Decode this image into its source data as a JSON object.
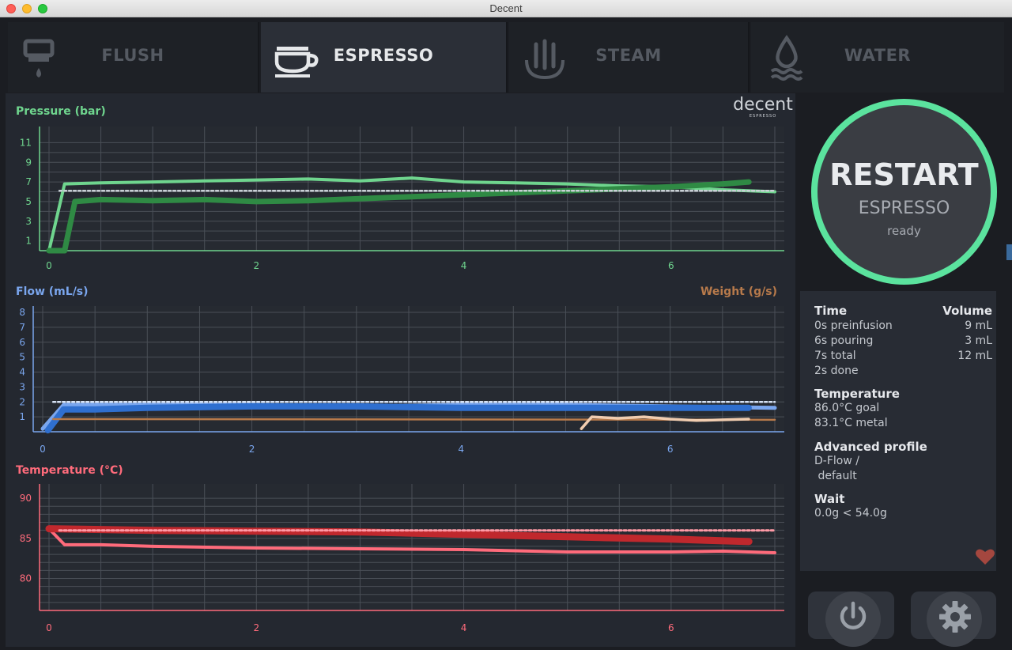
{
  "window": {
    "title": "Decent"
  },
  "tabs": [
    {
      "label": "FLUSH",
      "icon": "flush-icon",
      "active": false
    },
    {
      "label": "ESPRESSO",
      "icon": "espresso-cup-icon",
      "active": true
    },
    {
      "label": "STEAM",
      "icon": "steam-icon",
      "active": false
    },
    {
      "label": "WATER",
      "icon": "water-icon",
      "active": false
    }
  ],
  "logo": {
    "text": "decent",
    "subtext": "ESPRESSO"
  },
  "restart": {
    "title": "RESTART",
    "subtitle": "ESPRESSO",
    "state": "ready"
  },
  "stats": {
    "time_header": "Time",
    "volume_header": "Volume",
    "rows": [
      {
        "time": "0s preinfusion",
        "volume": "9 mL"
      },
      {
        "time": "6s pouring",
        "volume": "3 mL"
      },
      {
        "time": "7s total",
        "volume": "12 mL"
      },
      {
        "time": "2s done",
        "volume": ""
      }
    ],
    "temperature_header": "Temperature",
    "temperature_goal": "86.0°C goal",
    "temperature_metal": "83.1°C metal",
    "profile_header": "Advanced profile",
    "profile_line1": "D-Flow /",
    "profile_line2": " default",
    "wait_header": "Wait",
    "wait_value": "0.0g < 54.0g"
  },
  "colors": {
    "pressure": "#6fd58e",
    "pressure_dark": "#2f8a44",
    "flow": "#7aa6ee",
    "flow_dark": "#2f6fcf",
    "weight": "#b77a4b",
    "weight_light": "#f1cdb0",
    "temperature": "#ff6b7b",
    "temperature_dark": "#c0282d",
    "ring": "#5be39e"
  },
  "chart_data": [
    {
      "type": "line",
      "title": "Pressure (bar)",
      "xlim": [
        0,
        7
      ],
      "ylim": [
        0,
        12
      ],
      "x_ticks": [
        0,
        2,
        4,
        6
      ],
      "y_ticks": [
        1,
        3,
        5,
        7,
        9,
        11
      ],
      "series": [
        {
          "values": [
            [
              0,
              0
            ],
            [
              0.15,
              6.8
            ],
            [
              0.5,
              6.9
            ],
            [
              1,
              7.0
            ],
            [
              1.5,
              7.1
            ],
            [
              2,
              7.2
            ],
            [
              2.5,
              7.3
            ],
            [
              3,
              7.1
            ],
            [
              3.5,
              7.4
            ],
            [
              4,
              7.0
            ],
            [
              4.5,
              6.9
            ],
            [
              5,
              6.8
            ],
            [
              5.5,
              6.6
            ],
            [
              6,
              6.5
            ],
            [
              6.5,
              6.2
            ],
            [
              7,
              6.0
            ]
          ]
        },
        {
          "values": [
            [
              0,
              0
            ],
            [
              0.15,
              0
            ],
            [
              0.25,
              5.0
            ],
            [
              0.5,
              5.2
            ],
            [
              1,
              5.1
            ],
            [
              1.5,
              5.2
            ],
            [
              2,
              5.0
            ],
            [
              2.5,
              5.1
            ],
            [
              3,
              5.3
            ],
            [
              3.5,
              5.5
            ],
            [
              4,
              5.7
            ],
            [
              4.5,
              5.9
            ],
            [
              5,
              6.1
            ],
            [
              5.5,
              6.3
            ],
            [
              6,
              6.5
            ],
            [
              6.5,
              6.8
            ],
            [
              6.75,
              7.0
            ]
          ]
        },
        {
          "values": [
            [
              0.1,
              6.1
            ],
            [
              7,
              6.1
            ]
          ]
        }
      ]
    },
    {
      "type": "line",
      "title": "Flow (mL/s)",
      "y2label": "Weight (g/s)",
      "xlim": [
        0,
        7
      ],
      "ylim": [
        0,
        8
      ],
      "x_ticks": [
        0,
        2,
        4,
        6
      ],
      "y_ticks": [
        1,
        2,
        3,
        4,
        5,
        6,
        7,
        8
      ],
      "series": [
        {
          "values": [
            [
              0,
              0.2
            ],
            [
              0.2,
              1.8
            ],
            [
              0.5,
              1.8
            ],
            [
              1,
              1.8
            ],
            [
              2,
              1.8
            ],
            [
              3,
              1.7
            ],
            [
              4,
              1.8
            ],
            [
              5,
              1.8
            ],
            [
              6,
              1.7
            ],
            [
              7,
              1.6
            ]
          ]
        },
        {
          "values": [
            [
              0.05,
              0.1
            ],
            [
              0.2,
              1.5
            ],
            [
              0.5,
              1.5
            ],
            [
              1,
              1.6
            ],
            [
              2,
              1.7
            ],
            [
              3,
              1.7
            ],
            [
              4,
              1.6
            ],
            [
              5,
              1.6
            ],
            [
              6,
              1.6
            ],
            [
              6.75,
              1.6
            ]
          ]
        },
        {
          "values": [
            [
              0.1,
              2.0
            ],
            [
              7,
              2.0
            ]
          ]
        },
        {
          "values": [
            [
              0.1,
              0.85
            ],
            [
              7,
              0.8
            ]
          ]
        },
        {
          "values": [
            [
              5.15,
              0.2
            ],
            [
              5.25,
              1.0
            ],
            [
              5.5,
              0.9
            ],
            [
              5.75,
              1.0
            ],
            [
              6,
              0.85
            ],
            [
              6.25,
              0.75
            ],
            [
              6.5,
              0.8
            ],
            [
              6.75,
              0.85
            ]
          ]
        }
      ]
    },
    {
      "type": "line",
      "title": "Temperature (°C)",
      "xlim": [
        0,
        7
      ],
      "ylim": [
        76,
        91
      ],
      "x_ticks": [
        0,
        2,
        4,
        6
      ],
      "y_ticks": [
        80,
        85,
        90
      ],
      "series": [
        {
          "values": [
            [
              0,
              86.2
            ],
            [
              0.15,
              84.2
            ],
            [
              0.5,
              84.2
            ],
            [
              1,
              84.0
            ],
            [
              2,
              83.8
            ],
            [
              3,
              83.7
            ],
            [
              4,
              83.6
            ],
            [
              5,
              83.3
            ],
            [
              6,
              83.3
            ],
            [
              6.5,
              83.4
            ],
            [
              7,
              83.2
            ]
          ]
        },
        {
          "values": [
            [
              0,
              86.2
            ],
            [
              1,
              86.0
            ],
            [
              2,
              85.9
            ],
            [
              3,
              85.8
            ],
            [
              4,
              85.5
            ],
            [
              5,
              85.2
            ],
            [
              6,
              84.9
            ],
            [
              6.75,
              84.6
            ]
          ]
        },
        {
          "values": [
            [
              0.1,
              86.0
            ],
            [
              7,
              86.0
            ]
          ]
        }
      ]
    }
  ]
}
